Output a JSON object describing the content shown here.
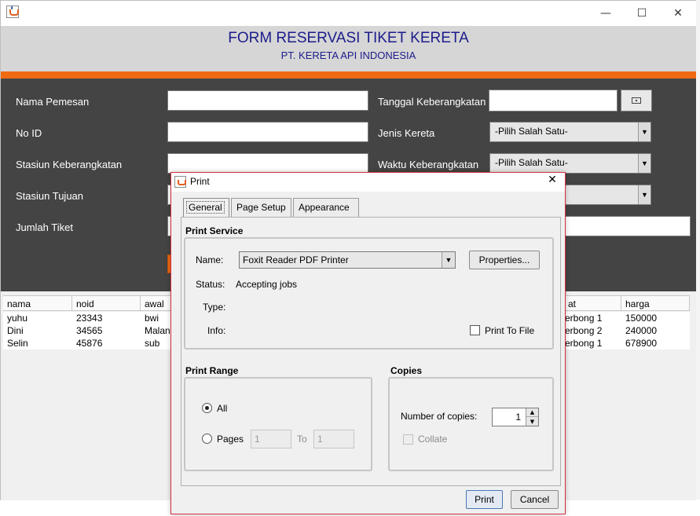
{
  "window": {
    "minimize_icon": "minimize-icon",
    "maximize_icon": "maximize-icon",
    "close_icon": "close-icon",
    "minimize_glyph": "—",
    "maximize_glyph": "☐",
    "close_glyph": "✕"
  },
  "header": {
    "title": "FORM RESERVASI TIKET KERETA",
    "subtitle": "PT. KERETA API INDONESIA"
  },
  "form": {
    "nama_pemesan_label": "Nama Pemesan",
    "no_id_label": "No ID",
    "stasiun_keberangkatan_label": "Stasiun Keberangkatan",
    "stasiun_tujuan_label": "Stasiun Tujuan",
    "jumlah_tiket_label": "Jumlah Tiket",
    "tanggal_keberangkatan_label": "Tanggal Keberangkatan",
    "jenis_kereta_label": "Jenis Kereta",
    "waktu_keberangkatan_label": "Waktu Keberangkatan",
    "jenis_kereta_value": "-Pilih Salah Satu-",
    "waktu_keberangkatan_value": "-Pilih Salah Satu-"
  },
  "table": {
    "headers": [
      "nama",
      "noid",
      "awal",
      "at",
      "harga"
    ],
    "rows": [
      {
        "nama": "yuhu",
        "noid": "23343",
        "awal": "bwi",
        "at": "erbong 1",
        "harga": "150000"
      },
      {
        "nama": "Dini",
        "noid": "34565",
        "awal": "Malang",
        "at": "erbong 2",
        "harga": "240000"
      },
      {
        "nama": "Selin",
        "noid": "45876",
        "awal": "sub",
        "at": "erbong 1",
        "harga": "678900"
      }
    ]
  },
  "dialog": {
    "title": "Print",
    "close_glyph": "✕",
    "tabs": {
      "general": "General",
      "page_setup": "Page Setup",
      "appearance": "Appearance"
    },
    "print_service": {
      "section": "Print Service",
      "name_label": "Name:",
      "name_value": "Foxit Reader PDF Printer",
      "properties_button": "Properties...",
      "status_label": "Status:",
      "status_value": "Accepting jobs",
      "type_label": "Type:",
      "info_label": "Info:",
      "print_to_file": "Print To File"
    },
    "print_range": {
      "section": "Print Range",
      "all_label": "All",
      "pages_label": "Pages",
      "pages_from": "1",
      "to_label": "To",
      "pages_to": "1"
    },
    "copies": {
      "section": "Copies",
      "number_label": "Number of copies:",
      "number_value": "1",
      "collate_label": "Collate"
    },
    "print_button": "Print",
    "cancel_button": "Cancel"
  }
}
